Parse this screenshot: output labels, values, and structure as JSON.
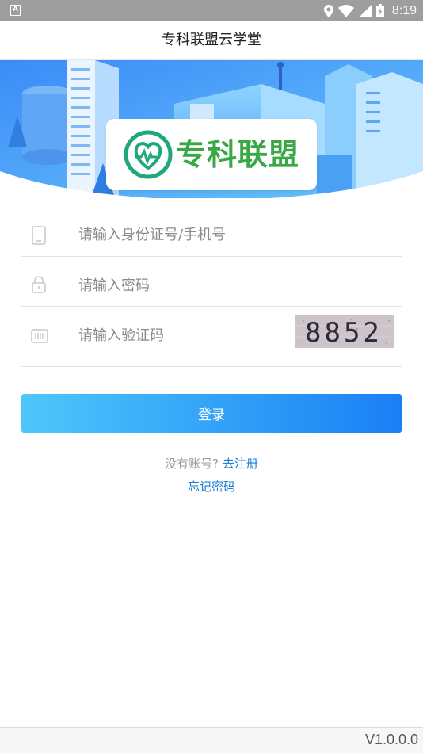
{
  "status_bar": {
    "notification_icon": "a-icon",
    "time": "8:19"
  },
  "header": {
    "title": "专科联盟云学堂"
  },
  "banner": {
    "logo_text": "专科联盟"
  },
  "form": {
    "id_field": {
      "placeholder": "请输入身份证号/手机号",
      "icon": "phone-icon"
    },
    "password_field": {
      "placeholder": "请输入密码",
      "icon": "lock-icon"
    },
    "captcha_field": {
      "placeholder": "请输入验证码",
      "icon": "keyboard-icon",
      "captcha_text": "8852"
    },
    "login_label": "登录"
  },
  "links": {
    "no_account": "没有账号?",
    "register": "去注册",
    "forgot_password": "忘记密码"
  },
  "footer": {
    "version": "V1.0.0.0"
  },
  "colors": {
    "accent": "#1a7cd9",
    "button_start": "#4ec7fb",
    "button_end": "#1a7ff5",
    "logo_green": "#39a845"
  }
}
